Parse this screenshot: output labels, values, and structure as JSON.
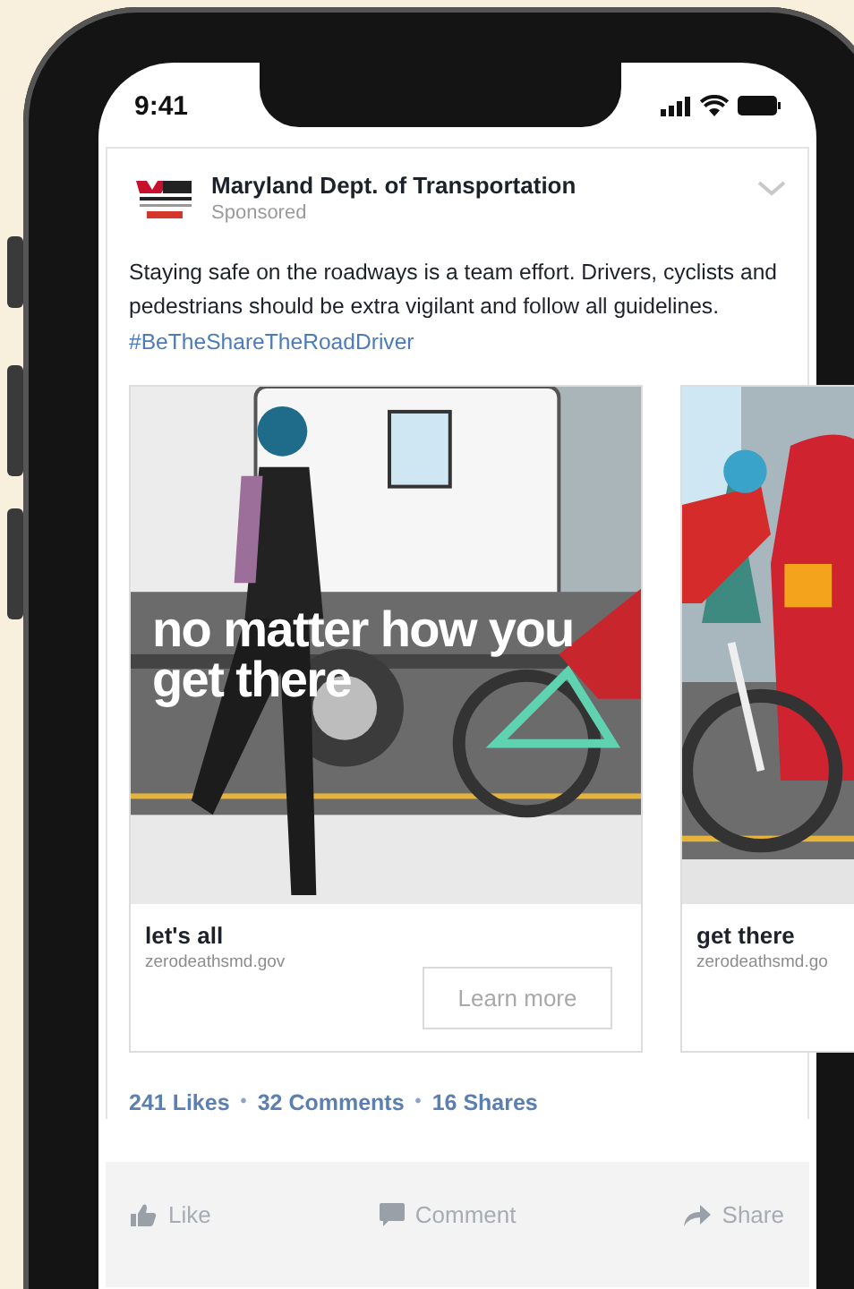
{
  "status_bar": {
    "time": "9:41"
  },
  "post": {
    "page_name": "Maryland Dept. of Transportation",
    "label": "Sponsored",
    "text": "Staying safe on the roadways is a team effort. Drivers, cyclists and pedestrians should be extra vigilant and follow all guidelines.",
    "hashtag": "#BeTheShareTheRoadDriver"
  },
  "carousel": [
    {
      "headline": "no matter how you get there",
      "title": "let's all",
      "domain": "zerodeathsmd.gov",
      "button": "Learn more"
    },
    {
      "title": "get there",
      "domain": "zerodeathsmd.go"
    }
  ],
  "stats": [
    {
      "kind": "count",
      "text": "241 Likes"
    },
    {
      "kind": "dot",
      "text": "•"
    },
    {
      "kind": "count",
      "text": "32 Comments"
    },
    {
      "kind": "dot",
      "text": "•"
    },
    {
      "kind": "count",
      "text": "16 Shares"
    }
  ],
  "actions": [
    {
      "label": "Like"
    },
    {
      "label": "Comment"
    },
    {
      "label": "Share"
    }
  ]
}
